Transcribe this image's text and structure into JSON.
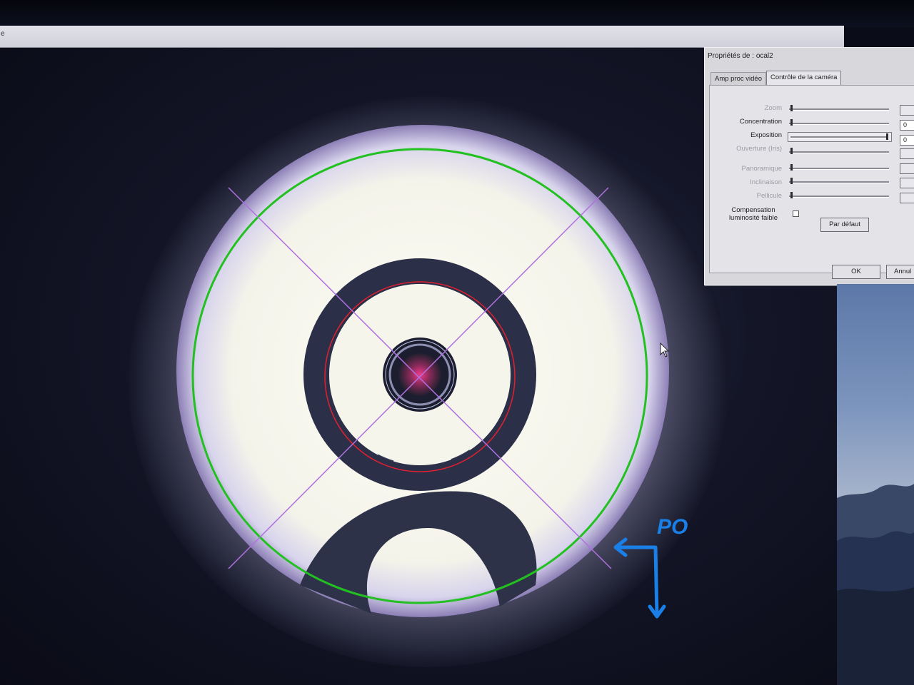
{
  "window": {
    "title_fragment": "e"
  },
  "overlay": {
    "annotation_label": "PO",
    "annotation_color": "#1a7fe6",
    "outer_circle_color": "#22c020",
    "inner_circle_color": "#e02030",
    "crosshair_color": "#b070e0"
  },
  "dialog": {
    "title": "Propriétés de : ocal2",
    "tabs": [
      {
        "label": "Amp proc vidéo",
        "active": false
      },
      {
        "label": "Contrôle de la caméra",
        "active": true
      }
    ],
    "controls": [
      {
        "label": "Zoom",
        "enabled": false,
        "value": ""
      },
      {
        "label": "Concentration",
        "enabled": true,
        "value": "0"
      },
      {
        "label": "Exposition",
        "enabled": true,
        "value": "0"
      },
      {
        "label": "Ouverture (Iris)",
        "enabled": false,
        "value": ""
      },
      {
        "label": "Panoramique",
        "enabled": false,
        "value": ""
      },
      {
        "label": "Inclinaison",
        "enabled": false,
        "value": ""
      },
      {
        "label": "Pellicule",
        "enabled": false,
        "value": ""
      }
    ],
    "compensation": {
      "line1": "Compensation",
      "line2": "luminosité faible",
      "checked": false
    },
    "default_button": "Par défaut",
    "ok_button": "OK",
    "cancel_button": "Annul"
  }
}
